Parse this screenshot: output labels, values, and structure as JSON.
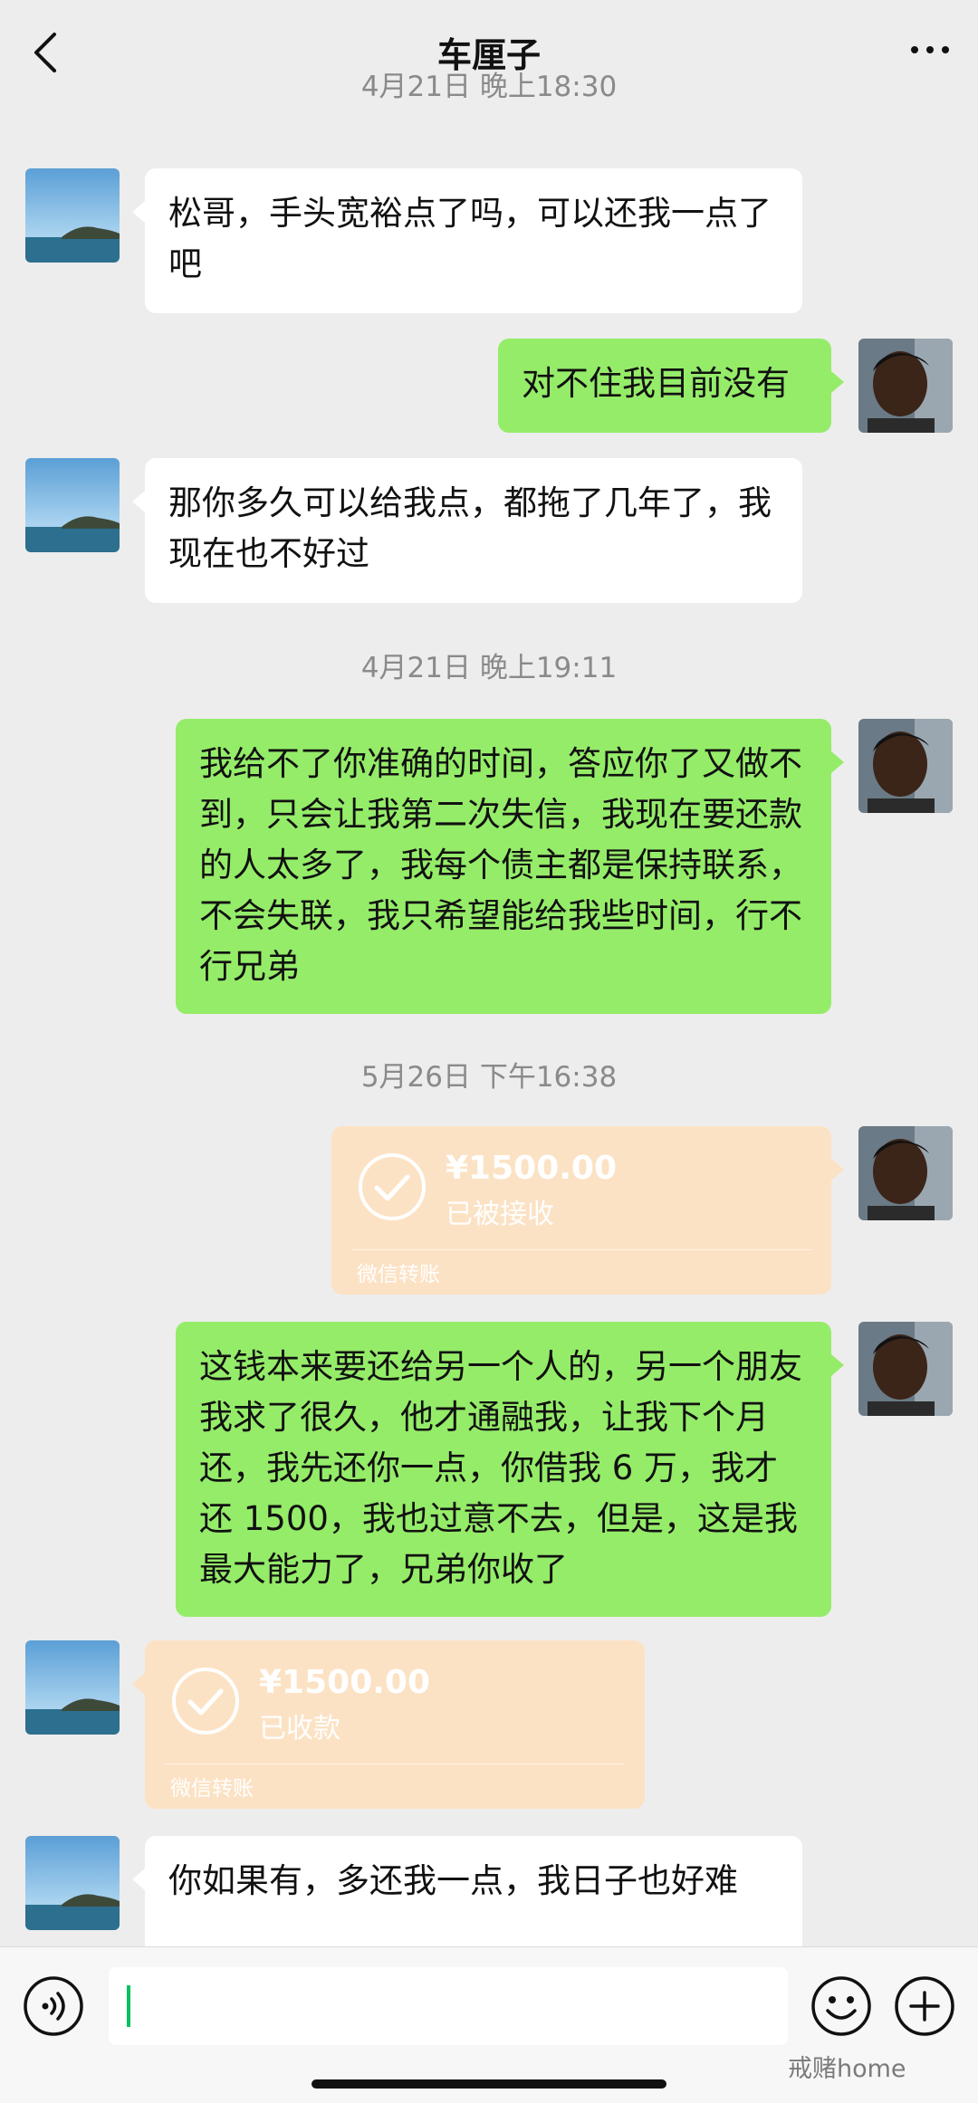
{
  "header": {
    "title": "车厘子",
    "back_icon": "chevron-left-icon",
    "more_icon": "more-horizontal-icon"
  },
  "timestamps": [
    "4月21日 晚上18:30",
    "4月21日 晚上19:11",
    "5月26日 下午16:38"
  ],
  "messages": [
    {
      "side": "left",
      "type": "text",
      "text": "松哥，手头宽裕点了吗，可以还我一点了吧"
    },
    {
      "side": "right",
      "type": "text",
      "text": "对不住我目前没有"
    },
    {
      "side": "left",
      "type": "text",
      "text": "那你多久可以给我点，都拖了几年了，我现在也不好过"
    },
    {
      "side": "right",
      "type": "text",
      "text": "我给不了你准确的时间，答应你了又做不到，只会让我第二次失信，我现在要还款的人太多了，我每个债主都是保持联系，不会失联，我只希望能给我些时间，行不行兄弟"
    },
    {
      "side": "right",
      "type": "transfer",
      "amount": "¥1500.00",
      "status": "已被接收",
      "footer": "微信转账"
    },
    {
      "side": "right",
      "type": "text",
      "text": "这钱本来要还给另一个人的，另一个朋友我求了很久，他才通融我，让我下个月还，我先还你一点，你借我 6 万，我才还 1500，我也过意不去，但是，这是我最大能力了，兄弟你收了"
    },
    {
      "side": "left",
      "type": "transfer",
      "amount": "¥1500.00",
      "status": "已收款",
      "footer": "微信转账"
    },
    {
      "side": "left",
      "type": "text",
      "text": "你如果有，多还我一点，我日子也好难"
    }
  ],
  "input": {
    "value": "",
    "placeholder": ""
  },
  "bottom_icons": {
    "voice": "voice-icon",
    "emoji": "emoji-icon",
    "plus": "plus-icon"
  },
  "watermark": "戒赌home",
  "colors": {
    "background": "#ededed",
    "bubble_self": "#95ec69",
    "bubble_other": "#ffffff",
    "transfer": "#fce2c4",
    "cursor": "#07c160"
  }
}
